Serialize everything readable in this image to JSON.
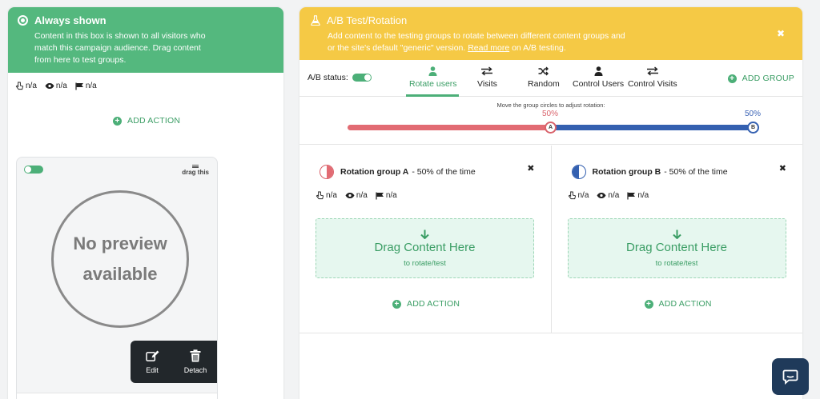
{
  "left": {
    "title": "Always shown",
    "desc_line1": "Content in this box is shown to all visitors who",
    "desc_line2": "match this campaign audience. Drag content",
    "desc_line3": "from here to test groups.",
    "stats": {
      "clicks": "n/a",
      "views": "n/a",
      "conversions": "n/a"
    },
    "add_action": "ADD ACTION",
    "card": {
      "drag_label": "drag this",
      "preview_line1": "No preview",
      "preview_line2": "available",
      "edit_label": "Edit",
      "detach_label": "Detach"
    }
  },
  "right": {
    "title": "A/B Test/Rotation",
    "desc_part1": "Add content to the testing groups to rotate between different content groups and",
    "desc_part2": "or the site's default \"generic\" version.",
    "read_more": "Read more",
    "desc_part3": "on A/B testing.",
    "ab_status_label": "A/B status:",
    "tabs": [
      {
        "label": "Rotate users"
      },
      {
        "label": "Visits"
      },
      {
        "label": "Random"
      },
      {
        "label": "Control Users"
      },
      {
        "label": "Control Visits"
      }
    ],
    "add_group": "ADD GROUP",
    "slider": {
      "caption": "Move the group circles to adjust rotation:",
      "a_pct": "50%",
      "b_pct": "50%",
      "a_label": "A",
      "b_label": "B",
      "a_share": 0.5
    },
    "groups": [
      {
        "name": "Rotation group A",
        "suffix": "- 50% of the time",
        "stats": {
          "clicks": "n/a",
          "views": "n/a",
          "conversions": "n/a"
        },
        "drop_title": "Drag Content Here",
        "drop_sub": "to rotate/test",
        "add_action": "ADD ACTION"
      },
      {
        "name": "Rotation group B",
        "suffix": "- 50% of the time",
        "stats": {
          "clicks": "n/a",
          "views": "n/a",
          "conversions": "n/a"
        },
        "drop_title": "Drag Content Here",
        "drop_sub": "to rotate/test",
        "add_action": "ADD ACTION"
      }
    ]
  },
  "colors": {
    "green": "#54b87e",
    "yellow": "#f5c945",
    "red": "#e26b73",
    "blue": "#3460b0"
  }
}
